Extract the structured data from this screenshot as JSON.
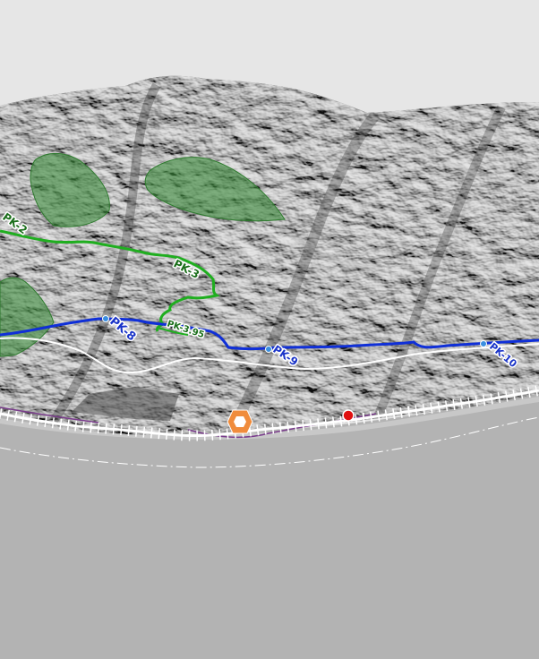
{
  "map": {
    "colors": {
      "sky": "#e6e6e6",
      "sea": "#b3b3b3",
      "terrain_dark": "#3a3a3a",
      "terrain_mid": "#6e6e6e",
      "terrain_light": "#a0a0a0",
      "forest_zone": "#3c8c3c",
      "green_trail": "#1fae1f",
      "blue_trail": "#0f2fd8",
      "road": "#ffffff",
      "boundary": "#7a3c8c",
      "railway": "#ffffff",
      "poi_orange": "#f08c3c",
      "poi_red": "#e01010"
    },
    "green_labels": {
      "pk2": "PK-2",
      "pk3": "PK-3",
      "pk395": "PK-3.95"
    },
    "blue_labels": {
      "pk8": "PK-8",
      "pk9": "PK-9",
      "pk10": "PK-10"
    },
    "markers": {
      "orange": "hexagon-marker-icon",
      "red": "red-dot-marker-icon"
    }
  }
}
